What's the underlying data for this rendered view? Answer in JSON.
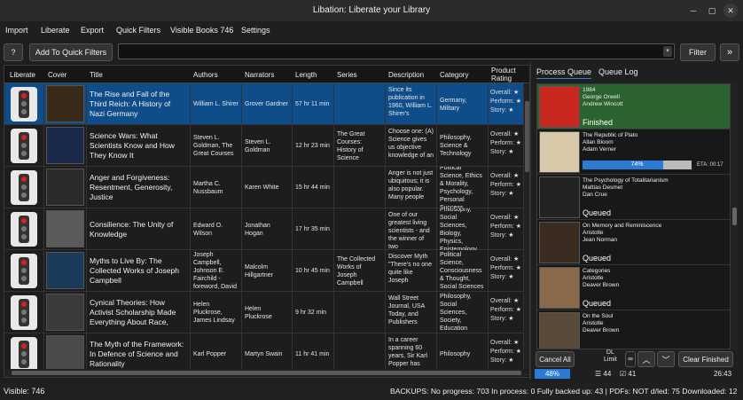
{
  "window": {
    "title": "Libation: Liberate your Library",
    "minimize": "─",
    "maximize": "▢",
    "close": "✕"
  },
  "menu": {
    "import": "Import",
    "liberate": "Liberate",
    "export": "Export",
    "quick_filters": "Quick Filters",
    "visible_books": "Visible Books 746",
    "settings": "Settings"
  },
  "toolbar": {
    "help": "?",
    "add_quick_filter": "Add To Quick Filters",
    "search_value": "",
    "filter": "Filter",
    "sidebar_toggle": "»"
  },
  "grid": {
    "columns": [
      "Liberate",
      "Cover",
      "Title",
      "Authors",
      "Narrators",
      "Length",
      "Series",
      "Description",
      "Category",
      "Product\nRating"
    ],
    "rows": [
      {
        "title": "The Rise and Fall of the Third Reich: A History of Nazi Germany",
        "authors": "William L. Shirer",
        "narrators": "Grover Gardner",
        "length": "57 hr 11 min",
        "series": "",
        "description": "Since its publication in 1960, William L. Shirer's",
        "category": "Germany, Military",
        "rating": "Overall: ★\nPerform: ★\nStory: ★"
      },
      {
        "title": "Science Wars: What Scientists Know and How They Know It",
        "authors": "Steven L. Goldman, The Great Courses",
        "narrators": "Steven L. Goldman",
        "length": "12 hr 23 min",
        "series": "The Great Courses: History of Science",
        "description": "Choose one: (A) Science gives us objective knowledge of an",
        "category": "Philosophy, Science & Technology",
        "rating": "Overall: ★\nPerform: ★\nStory: ★"
      },
      {
        "title": "Anger and Forgiveness: Resentment, Generosity, Justice",
        "authors": "Martha C. Nussbaum",
        "narrators": "Karen White",
        "length": "15 hr 44 min",
        "series": "",
        "description": "Anger is not just ubiquitous; it is also popular. Many people",
        "category": "Political Science, Ethics & Morality, Psychology, Personal Success",
        "rating": "Overall: ★\nPerform: ★\nStory: ★"
      },
      {
        "title": "Consilience: The Unity of Knowledge",
        "authors": "Edward O. Wilson",
        "narrators": "Jonathan Hogan",
        "length": "17 hr 35 min",
        "series": "",
        "description": "One of our greatest living scientists - and the winner of two",
        "category": "Philosophy, Social Sciences, Biology, Physics, Epistemology",
        "rating": "Overall: ★\nPerform: ★\nStory: ★"
      },
      {
        "title": "Myths to Live By: The Collected Works of Joseph Campbell",
        "authors": "Joseph Campbell, Johnson E. Fairchild - foreword, David",
        "narrators": "Malcolm Hillgartner",
        "length": "10 hr 45 min",
        "series": "The Collected Works of Joseph Campbell",
        "description": "Discover Myth \"There's no one quite like Joseph",
        "category": "Political Science, Consciousness & Thought, Social Sciences",
        "rating": "Overall: ★\nPerform: ★\nStory: ★"
      },
      {
        "title": "Cynical Theories: How Activist Scholarship Made Everything About Race,",
        "authors": "Helen Pluckrose, James Lindsay",
        "narrators": "Helen Pluckrose",
        "length": "9 hr 32 min",
        "series": "",
        "description": "Wall Street Journal, USA Today, and Publishers",
        "category": "Philosophy, Social Sciences, Society, Education",
        "rating": "Overall: ★\nPerform: ★\nStory: ★"
      },
      {
        "title": "The Myth of the Framework: In Defence of Science and Rationality",
        "authors": "Karl Popper",
        "narrators": "Martyn Swain",
        "length": "11 hr 41 min",
        "series": "",
        "description": "In a career spanning 60 years, Sir Karl Popper has made",
        "category": "Philosophy",
        "rating": "Overall: ★\nPerform: ★\nStory: ★"
      }
    ]
  },
  "queue": {
    "tab_process": "Process Queue",
    "tab_log": "Queue Log",
    "items": [
      {
        "title": "1984",
        "author": "George Orwell",
        "narrator": "Andrew Wincott",
        "status": "Finished"
      },
      {
        "title": "The Republic of Plato",
        "author": "Allan Bloom",
        "narrator": "Adam Verner",
        "progress_label": "74%",
        "eta": "ETA: 00:17"
      },
      {
        "title": "The Psychology of Totalitarianism",
        "author": "Mattias Desmet",
        "narrator": "Dan Crue",
        "status": "Queued"
      },
      {
        "title": "On Memory and Reminiscence",
        "author": "Aristotle",
        "narrator": "Jean Norman",
        "status": "Queued"
      },
      {
        "title": "Categories",
        "author": "Aristotle",
        "narrator": "Deaver Brown",
        "status": "Queued"
      },
      {
        "title": "On the Soul",
        "author": "Aristotle",
        "narrator": "Deaver Brown",
        "status": ""
      }
    ],
    "cancel_all": "Cancel All",
    "dl_limit": "DL\nLimit",
    "dl_limit_value": "∞",
    "up": "︿",
    "down": "﹀",
    "clear_finished": "Clear Finished",
    "overall_progress": "48%",
    "queued_count": "44",
    "done_count": "41",
    "time": "26:43"
  },
  "status": {
    "visible": "Visible: 746",
    "backups": "BACKUPS: No progress: 703  In process: 0  Fully backed up: 43  |  PDFs: NOT d/led: 75  Downloaded: 12"
  },
  "colors": {
    "selection": "#0f4d8a",
    "finished": "#2b6330",
    "progress": "#2a7bd6"
  }
}
